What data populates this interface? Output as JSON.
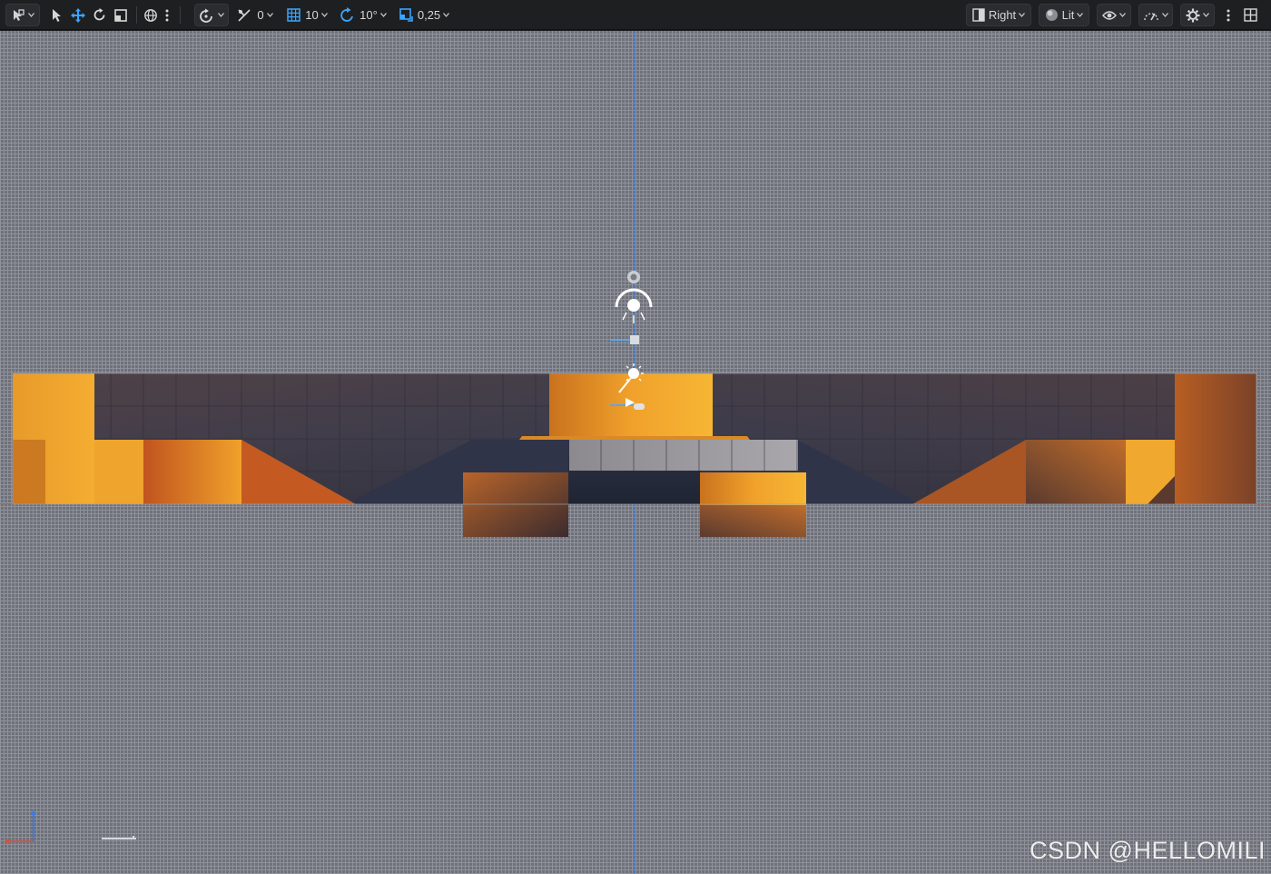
{
  "toolbar": {
    "select_mode_icon": "select-mode-icon",
    "tools": [
      "select-arrow-icon",
      "translate-icon",
      "rotate-icon",
      "scale-icon"
    ],
    "coord_space_icon": "globe-icon",
    "surface_snap": {
      "icon": "surface-snap-icon"
    },
    "translate_snap": {
      "icon": "grid-snap-icon",
      "value": "0"
    },
    "grid_snap": {
      "icon": "grid-icon",
      "value": "10"
    },
    "rotation_snap": {
      "icon": "rotation-snap-icon",
      "value": "10°"
    },
    "scale_snap": {
      "icon": "scale-snap-icon",
      "value": "0,25"
    },
    "view_mode": {
      "icon": "viewport-icon",
      "label": "Right"
    },
    "view_lighting": {
      "icon": "lit-sphere-icon",
      "label": "Lit"
    },
    "show_flags_icon": "eye-icon",
    "realtime_icon": "realtime-icon",
    "settings_icon": "gear-icon",
    "more_icon": "more-vertical-icon",
    "layout_icon": "layout-grid-icon"
  },
  "viewport": {
    "background_color": "#6e7179",
    "grid_color": "#8f929a",
    "axis_vertical_color": "#3d7be0",
    "axis_horizontal_color": "#c8584a"
  },
  "watermark": "CSDN @HELLOMILI"
}
